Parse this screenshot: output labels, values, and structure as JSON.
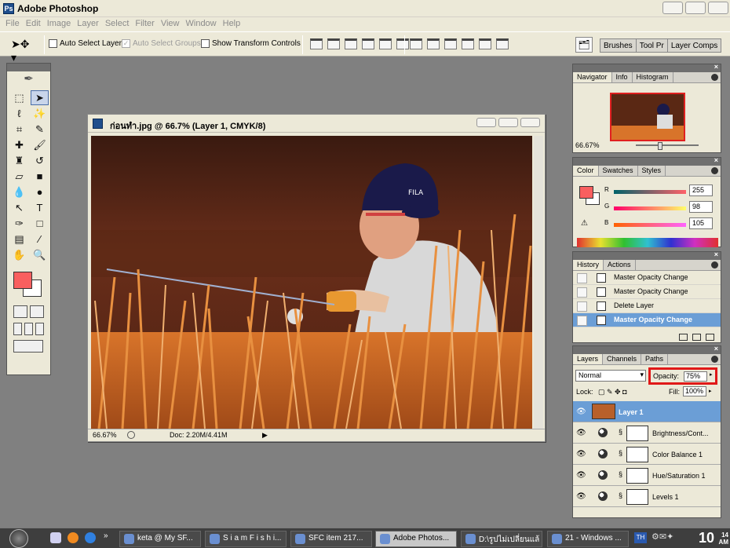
{
  "app": {
    "title": "Adobe Photoshop"
  },
  "menu": [
    "File",
    "Edit",
    "Image",
    "Layer",
    "Select",
    "Filter",
    "View",
    "Window",
    "Help"
  ],
  "options": {
    "auto_select_layer": "Auto Select Layer",
    "auto_select_groups": "Auto Select Groups",
    "show_transform_controls": "Show Transform Controls",
    "well_tabs": [
      "Brushes",
      "Tool Pr",
      "Layer Comps"
    ]
  },
  "document": {
    "title": "ก่อนทำ.jpg @ 66.7% (Layer 1, CMYK/8)",
    "zoom": "66.67%",
    "doc_size": "Doc: 2.20M/4.41M"
  },
  "navigator": {
    "tabs": [
      "Navigator",
      "Info",
      "Histogram"
    ],
    "zoom": "66.67%"
  },
  "color": {
    "tabs": [
      "Color",
      "Swatches",
      "Styles"
    ],
    "r_label": "R",
    "g_label": "G",
    "b_label": "B",
    "r": "255",
    "g": "98",
    "b": "105",
    "fg_color": "#f95f5f"
  },
  "history": {
    "tabs": [
      "History",
      "Actions"
    ],
    "items": [
      "Master Opacity Change",
      "Master Opacity Change",
      "Delete Layer",
      "Master Opacity Change"
    ]
  },
  "layers": {
    "tabs": [
      "Layers",
      "Channels",
      "Paths"
    ],
    "blend_mode": "Normal",
    "opacity_label": "Opacity:",
    "opacity": "75%",
    "lock_label": "Lock:",
    "fill_label": "Fill:",
    "fill": "100%",
    "items": [
      "Layer 1",
      "Brightness/Cont...",
      "Color Balance 1",
      "Hue/Saturation 1",
      "Levels 1"
    ]
  },
  "taskbar": {
    "items": [
      "keta @ My SF...",
      "S i a m F i s h i...",
      "SFC item 217...",
      "Adobe Photos...",
      "D:\\รูปไม่เปลี่ยนแล้",
      "21 - Windows ..."
    ],
    "time": "10",
    "time_min": "14",
    "time_ampm": "AM",
    "lang": "TH"
  }
}
